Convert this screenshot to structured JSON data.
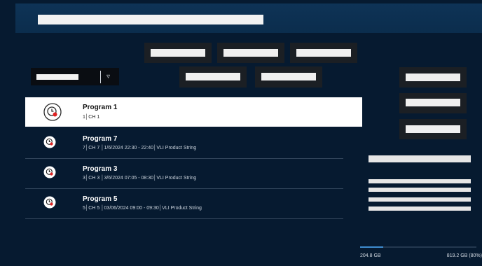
{
  "header": {
    "title": ""
  },
  "filters": {
    "dropdown_value": "",
    "chevron": "▿"
  },
  "buttons": {
    "top_row": [
      "",
      "",
      ""
    ],
    "second_row": [
      "",
      ""
    ],
    "right_column": [
      "",
      "",
      ""
    ]
  },
  "recordings": [
    {
      "title": "Program 1",
      "subtitle": "1│CH 1",
      "icon": "clock-record-icon",
      "selected": true
    },
    {
      "title": "Program 7",
      "subtitle": "7│CH 7 │1/6/2024  22:30 - 22:40│VLI Product String",
      "icon": "clock-record-icon",
      "selected": false
    },
    {
      "title": "Program 3",
      "subtitle": " 3│CH 3 │3/6/2024  07:05 - 08:30│VLI Product String",
      "icon": "clock-record-icon",
      "selected": false
    },
    {
      "title": "Program 5",
      "subtitle": "5│CH 5 │03/06/2024  09:00 - 09:30│VLI Product String",
      "icon": "clock-record-icon",
      "selected": false
    }
  ],
  "storage": {
    "used_label": "204.8 GB",
    "free_label": "819.2 GB (80%)",
    "used_fraction": 0.2
  },
  "colors": {
    "background": "#061a30",
    "accent": "#3e8ccf",
    "record_red": "#e02020"
  }
}
